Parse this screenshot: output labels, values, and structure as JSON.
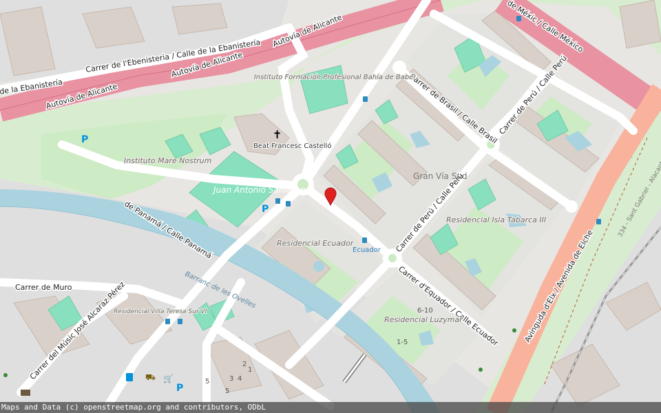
{
  "map": {
    "attribution": "Maps and Data (c) openstreetmap.org and contributors, ODbL",
    "colors": {
      "motorway": "#e892a2",
      "trunk": "#f9b29c",
      "park": "#c8facc",
      "pitch": "#88e0be",
      "water": "#aad3df",
      "residential": "#e0dfdf",
      "building": "#d9d0c9"
    },
    "roads": {
      "ebanisteria_top": "Carrer de l'Ebenisteria / Calle de la Ebanistería",
      "ebanisteria_left": "de la Ebanistería",
      "autovia_1": "Autovía de Alicante",
      "autovia_2": "Autovía de Alicante",
      "autovia_3": "Autovía de Alicante",
      "mexico": "de Méxic / Calle México",
      "brasil": "Carrer de Brasil / Calle Brasil",
      "peru_top": "Carrer de Perú / Calle Perú",
      "peru_mid": "Carrer de Perú / Calle Perú",
      "panama": "de Panamá / Calle Panamá",
      "equador": "Carrer d'Equador / Calle Ecuador",
      "muro": "Carrer de Muro",
      "alcaraz": "Carrer del Músic José Alcaraz Pérez",
      "elx": "Avinguda d'Elx / Avenida de Elche",
      "rail": "334 - Sant Gabriel - Alacant",
      "barranc": "Barranc de les Ovelles"
    },
    "places": {
      "instituto_bahia": "Instituto Formación Profesional Bahía de Babel",
      "mare_nostrum": "Instituto Mare Nostrum",
      "beat": "Beat Francesc Castelló",
      "samaranch": "Juan Antonio Samaranch",
      "gran_via": "Gran Vía Sud",
      "res_ecuador": "Residencial Ecuador",
      "isla_tabarca": "Residencial Isla Tabarca III",
      "villa_teresa": "Residencial Villa Teresa Sur VI",
      "luzymar": "Residencial Luzymar",
      "ecuador_stop": "Ecuador"
    },
    "house_numbers": [
      "6-10",
      "1-5",
      "2",
      "1",
      "4",
      "3",
      "5",
      "5"
    ],
    "icons": [
      "parking-icon",
      "bus-stop-icon",
      "church-icon",
      "marker-icon",
      "fuel-icon",
      "shop-icon",
      "tree-icon"
    ]
  }
}
